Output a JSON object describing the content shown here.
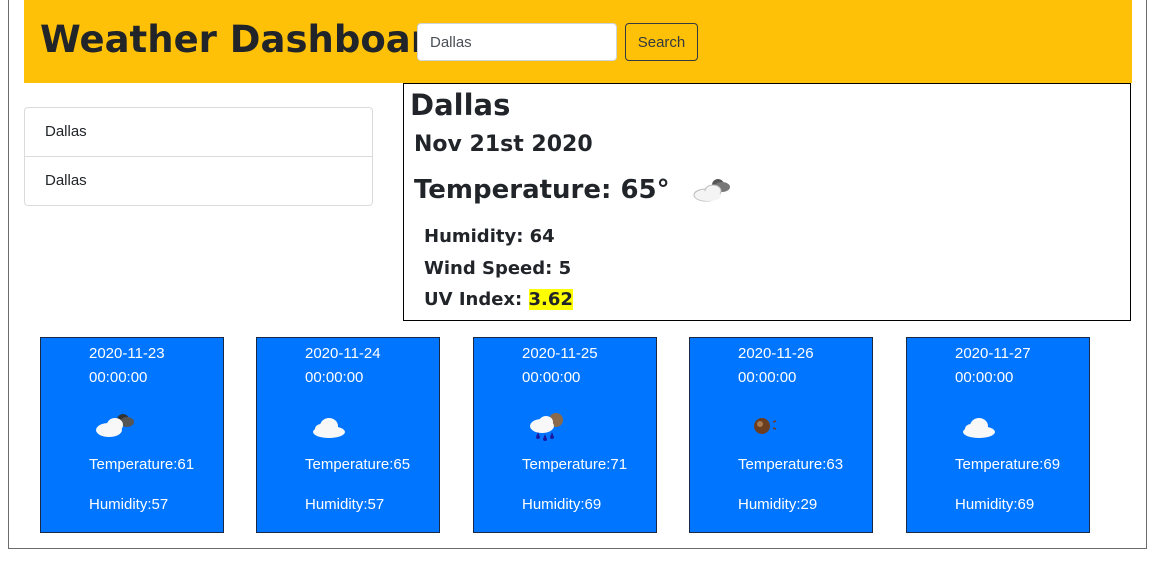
{
  "header": {
    "title": "Weather Dashboard",
    "search_value": "Dallas",
    "search_button": "Search"
  },
  "history": [
    "Dallas",
    "Dallas"
  ],
  "current": {
    "city": "Dallas",
    "date": "Nov 21st 2020",
    "temperature": "Temperature: 65°",
    "icon": "partly-cloudy-icon",
    "humidity": "Humidity: 64",
    "wind": "Wind Speed: 5",
    "uv_label": "UV Index: ",
    "uv_value": "3.62",
    "uv_color": "#ffff00"
  },
  "forecast": [
    {
      "date": "2020-11-23",
      "time": "00:00:00",
      "icon": "partly-cloudy-icon",
      "temp": "Temperature:61",
      "humidity": "Humidity:57"
    },
    {
      "date": "2020-11-24",
      "time": "00:00:00",
      "icon": "cloud-icon",
      "temp": "Temperature:65",
      "humidity": "Humidity:57"
    },
    {
      "date": "2020-11-25",
      "time": "00:00:00",
      "icon": "rain-icon",
      "temp": "Temperature:71",
      "humidity": "Humidity:69"
    },
    {
      "date": "2020-11-26",
      "time": "00:00:00",
      "icon": "sun-icon",
      "temp": "Temperature:63",
      "humidity": "Humidity:29"
    },
    {
      "date": "2020-11-27",
      "time": "00:00:00",
      "icon": "cloud-icon",
      "temp": "Temperature:69",
      "humidity": "Humidity:69"
    }
  ],
  "colors": {
    "header_bg": "#ffc107",
    "card_bg": "#0075ff",
    "uv_highlight": "#ffff00"
  }
}
